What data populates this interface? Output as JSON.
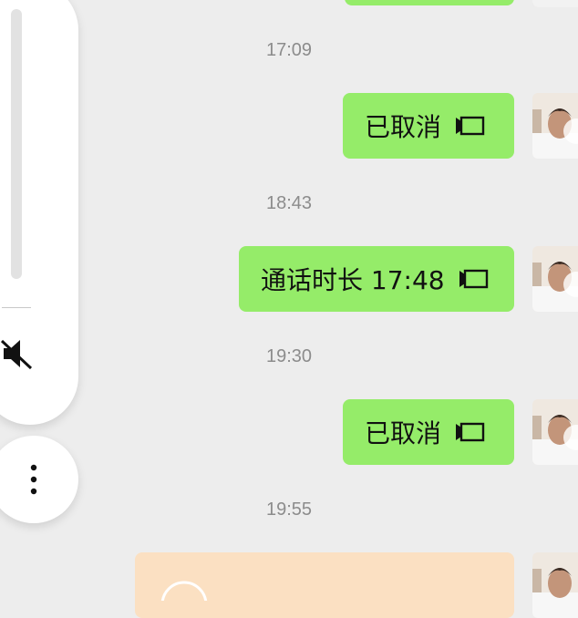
{
  "messages": [
    {
      "time": "17:09",
      "text": "已取消"
    },
    {
      "time": "18:43",
      "text": "通话时长 17:48"
    },
    {
      "time": "19:30",
      "text": "已取消"
    },
    {
      "time": "19:55"
    }
  ],
  "colors": {
    "background": "#ededed",
    "sent_bubble": "#95ec69",
    "payment_bubble": "#fbe0c2",
    "timestamp": "#8c8c8c"
  },
  "icons": {
    "video_call": "video-call-icon",
    "mute": "mute-icon",
    "more": "more-vertical-icon"
  }
}
